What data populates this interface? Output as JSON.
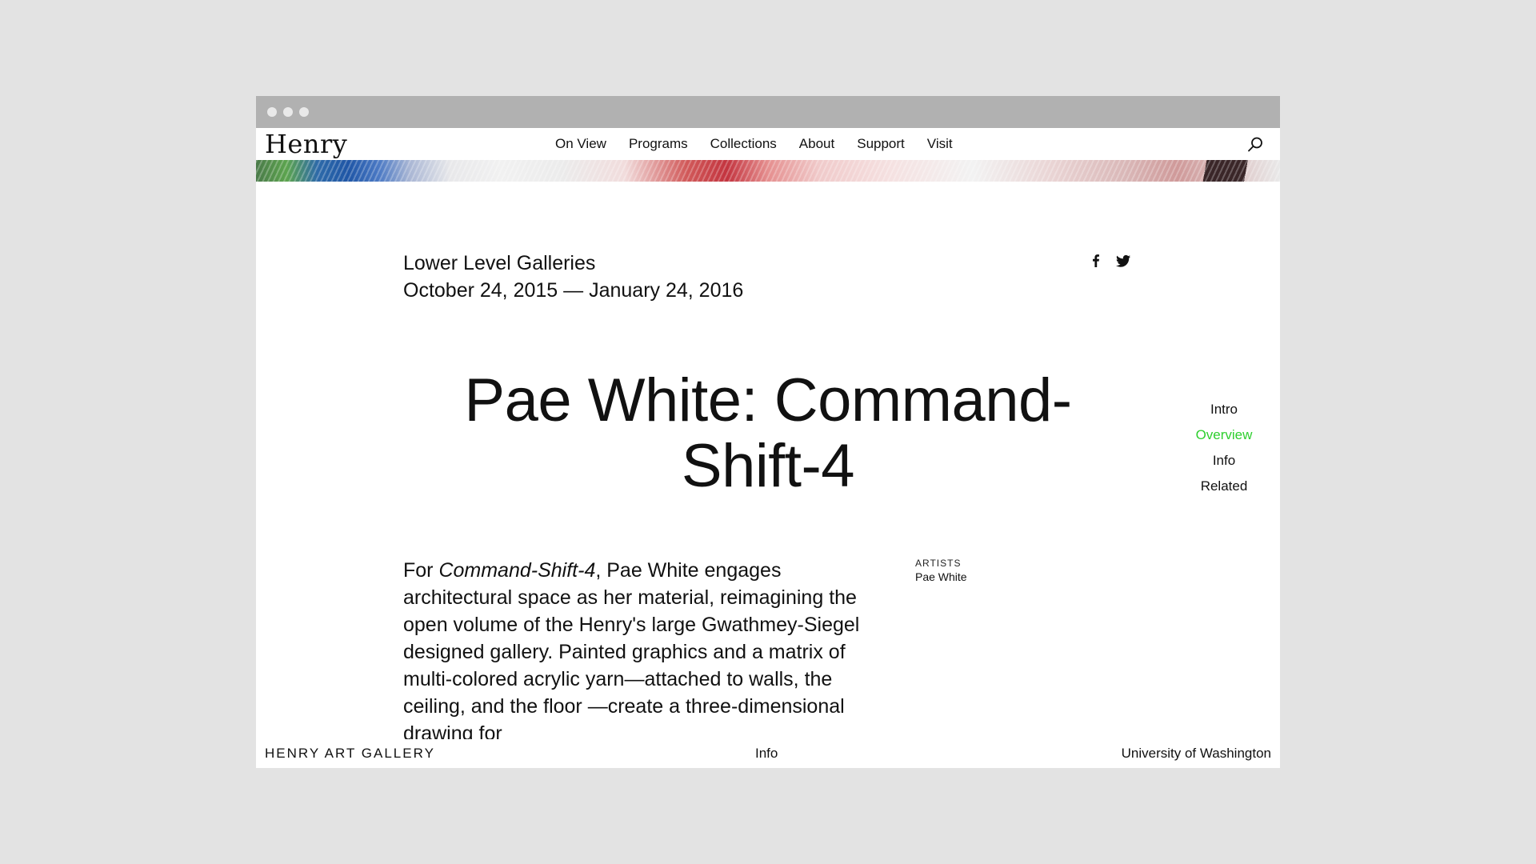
{
  "site": {
    "logo": "Henry"
  },
  "nav": {
    "items": [
      "On View",
      "Programs",
      "Collections",
      "About",
      "Support",
      "Visit"
    ]
  },
  "exhibition": {
    "location": "Lower Level Galleries",
    "dates": "October 24, 2015 — January 24, 2016",
    "title_line1": "Pae White: Command-",
    "title_line2": "Shift-4",
    "body_prefix": "For ",
    "body_italic": "Command-Shift-4",
    "body_rest": ", Pae White engages architectural space as her material, reimagining the open volume of the Henry's large Gwathmey-Siegel designed gallery. Painted graphics and a matrix of multi-colored acrylic yarn—attached to walls, the ceiling, and the floor —create a three-dimensional drawing for",
    "artists_label": "ARTISTS",
    "artist_name": "Pae White"
  },
  "side_nav": {
    "items": [
      "Intro",
      "Overview",
      "Info",
      "Related"
    ],
    "active": "Overview",
    "active_color": "#2ecf2e"
  },
  "footer": {
    "left": "HENRY ART GALLERY",
    "center": "Info",
    "right": "University of Washington"
  },
  "icons": {
    "search": "search-icon",
    "facebook": "facebook-icon",
    "twitter": "twitter-icon"
  }
}
